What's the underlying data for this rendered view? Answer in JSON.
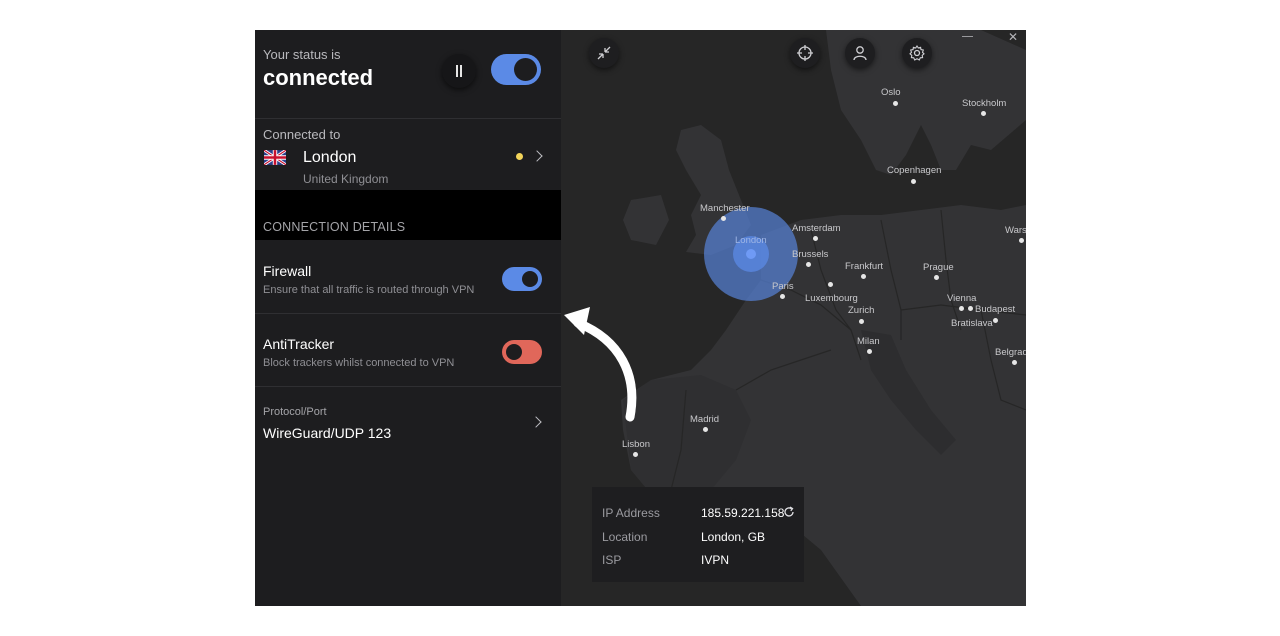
{
  "status": {
    "label": "Your status is",
    "value": "connected",
    "main_toggle_on": true
  },
  "connection": {
    "label": "Connected to",
    "city": "London",
    "country": "United Kingdom",
    "indicator_color": "#f3d45a"
  },
  "details": {
    "heading": "CONNECTION DETAILS",
    "firewall": {
      "title": "Firewall",
      "description": "Ensure that all traffic is routed through VPN",
      "on": true
    },
    "antitracker": {
      "title": "AntiTracker",
      "description": "Block trackers whilst connected to VPN",
      "on": false
    },
    "protocol": {
      "label": "Protocol/Port",
      "value": "WireGuard/UDP 123"
    }
  },
  "map": {
    "cities": [
      {
        "name": "Oslo"
      },
      {
        "name": "Stockholm"
      },
      {
        "name": "Copenhagen"
      },
      {
        "name": "Manchester"
      },
      {
        "name": "London"
      },
      {
        "name": "Amsterdam"
      },
      {
        "name": "Brussels"
      },
      {
        "name": "Frankfurt"
      },
      {
        "name": "Prague"
      },
      {
        "name": "Warsaw"
      },
      {
        "name": "Paris"
      },
      {
        "name": "Luxembourg"
      },
      {
        "name": "Vienna"
      },
      {
        "name": "Budapest"
      },
      {
        "name": "Bratislava"
      },
      {
        "name": "Zurich"
      },
      {
        "name": "Milan"
      },
      {
        "name": "Belgrade"
      },
      {
        "name": "Madrid"
      },
      {
        "name": "Lisbon"
      }
    ]
  },
  "info": {
    "ip_label": "IP Address",
    "ip_value": "185.59.221.158",
    "location_label": "Location",
    "location_value": "London, GB",
    "isp_label": "ISP",
    "isp_value": "IVPN"
  },
  "colors": {
    "accent_blue": "#5b8ae6",
    "off_red": "#e0675a",
    "panel_bg": "#1d1d1f",
    "map_bg": "#262626"
  },
  "icons": [
    "pause-icon",
    "uk-flag-icon",
    "chevron-right-icon",
    "compress-icon",
    "target-icon",
    "user-icon",
    "gear-icon",
    "refresh-icon",
    "close-icon",
    "minimize-icon",
    "curved-arrow-icon"
  ]
}
